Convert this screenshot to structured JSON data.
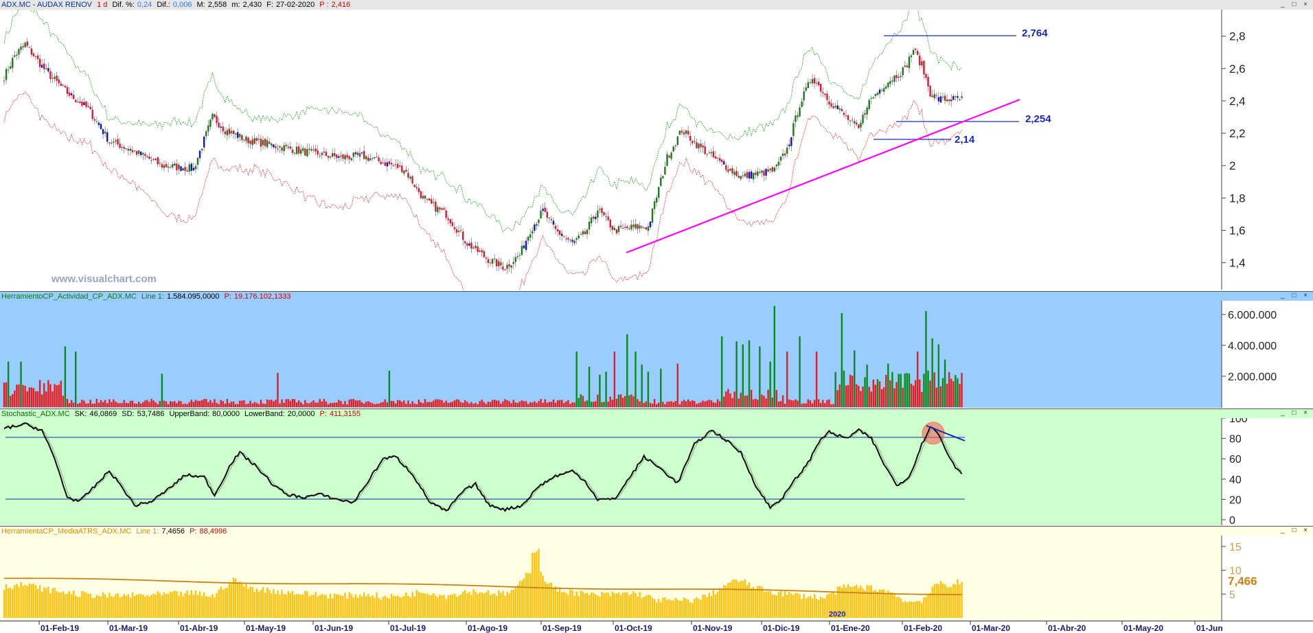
{
  "panel1": {
    "symbol": "ADX.MC - AUDAX RENOV",
    "period": "1 d",
    "dif_pct_label": "Dif. %:",
    "dif_pct": "0,24",
    "dif_label": "Dif.:",
    "dif": "0,006",
    "max_label": "M:",
    "max": "2,558",
    "min_label": "m:",
    "min": "2,430",
    "date_label": "F:",
    "date": "27-02-2020",
    "price_label": "P :",
    "price": "2,416",
    "watermark": "www.visualchart.com",
    "yticks": [
      "2,8",
      "2,6",
      "2,4",
      "2,2",
      "2",
      "1,8",
      "1,6",
      "1,4"
    ],
    "annotations": [
      "2,764",
      "2,254",
      "2,14"
    ]
  },
  "panel2": {
    "name": "HerramientoCP_Actividad_CP_ADX.MC",
    "line_label": "Line 1:",
    "line_value": "1.584.095,0000",
    "p_label": "P:",
    "p_value": "19.176.102,1333",
    "yticks": [
      "6.000.000",
      "4.000.000",
      "2.000.000"
    ]
  },
  "panel3": {
    "name": "Stochastic_ADX.MC",
    "sk_label": "SK:",
    "sk": "46,0869",
    "sd_label": "SD:",
    "sd": "53,7486",
    "ub_label": "UpperBand:",
    "ub": "80,0000",
    "lb_label": "LowerBand:",
    "lb": "20,0000",
    "p_label": "P:",
    "p_value": "411,3155",
    "yticks": [
      "100",
      "80",
      "60",
      "40",
      "20",
      "0"
    ]
  },
  "panel4": {
    "name": "HerramientaCP_MediaATRS_ADX.MC",
    "line_label": "Line 1:",
    "line_value": "7,4656",
    "p_label": "P:",
    "p_value": "88,4996",
    "yticks": [
      "15",
      "10",
      "5"
    ],
    "last_value": "7,466",
    "year_marker": "2020"
  },
  "xaxis": [
    "01-Feb-19",
    "01-Mar-19",
    "01-Abr-19",
    "01-May-19",
    "01-Jun-19",
    "01-Jul-19",
    "01-Ago-19",
    "01-Sep-19",
    "01-Oct-19",
    "01-Nov-19",
    "01-Dic-19",
    "01-Ene-20",
    "01-Feb-20",
    "01-Mar-20",
    "01-Abr-20",
    "01-May-20",
    "01-Jun"
  ],
  "window_buttons": "_ □ ×",
  "colors": {
    "up": "#1a7a1a",
    "down": "#e8112d",
    "blue": "#1010c0",
    "magenta": "#ff00ff",
    "band_upper": "#0a9a0a",
    "band_lower": "#e82020",
    "vol_bg": "#99ccff",
    "stoch_bg": "#ccffcc",
    "atr_bg": "#ffffe6",
    "atr_bar": "#ffc20e",
    "atr_line": "#c88214"
  },
  "chart_data": [
    {
      "type": "candlestick",
      "title": "ADX.MC - AUDAX RENOV",
      "y_range": [
        1.25,
        2.93
      ],
      "annotated_levels": [
        2.764,
        2.254,
        2.14
      ],
      "monthly_close_approx": {
        "months": [
          "Feb-19",
          "Mar-19",
          "Abr-19",
          "May-19",
          "Jun-19",
          "Jul-19",
          "Ago-19",
          "Sep-19",
          "Oct-19",
          "Nov-19",
          "Dic-19",
          "Ene-20",
          "Feb-20"
        ],
        "close": [
          2.62,
          2.08,
          1.99,
          2.22,
          2.08,
          2.05,
          1.68,
          1.57,
          1.62,
          2.02,
          2.05,
          2.35,
          2.42
        ]
      },
      "anchors": [
        [
          0,
          2.55
        ],
        [
          5,
          2.68
        ],
        [
          10,
          2.75
        ],
        [
          20,
          2.58
        ],
        [
          30,
          2.45
        ],
        [
          40,
          2.35
        ],
        [
          50,
          2.15
        ],
        [
          60,
          2.1
        ],
        [
          75,
          2.0
        ],
        [
          90,
          1.98
        ],
        [
          99,
          2.3
        ],
        [
          105,
          2.22
        ],
        [
          115,
          2.16
        ],
        [
          130,
          2.12
        ],
        [
          145,
          2.08
        ],
        [
          160,
          2.05
        ],
        [
          170,
          2.06
        ],
        [
          180,
          2.02
        ],
        [
          190,
          1.98
        ],
        [
          200,
          1.78
        ],
        [
          210,
          1.7
        ],
        [
          220,
          1.52
        ],
        [
          230,
          1.42
        ],
        [
          238,
          1.37
        ],
        [
          245,
          1.45
        ],
        [
          250,
          1.6
        ],
        [
          256,
          1.72
        ],
        [
          262,
          1.6
        ],
        [
          270,
          1.52
        ],
        [
          276,
          1.58
        ],
        [
          282,
          1.73
        ],
        [
          290,
          1.6
        ],
        [
          300,
          1.62
        ],
        [
          306,
          1.62
        ],
        [
          315,
          2.05
        ],
        [
          322,
          2.22
        ],
        [
          330,
          2.12
        ],
        [
          340,
          2.02
        ],
        [
          350,
          1.93
        ],
        [
          358,
          1.95
        ],
        [
          366,
          1.97
        ],
        [
          372,
          2.1
        ],
        [
          378,
          2.38
        ],
        [
          384,
          2.55
        ],
        [
          392,
          2.4
        ],
        [
          400,
          2.3
        ],
        [
          406,
          2.22
        ],
        [
          410,
          2.38
        ],
        [
          418,
          2.5
        ],
        [
          424,
          2.56
        ],
        [
          428,
          2.6
        ],
        [
          432,
          2.72
        ],
        [
          436,
          2.62
        ],
        [
          440,
          2.45
        ],
        [
          444,
          2.41
        ]
      ]
    },
    {
      "type": "bar",
      "title": "HerramientoCP_Actividad_CP_ADX.MC",
      "y_range": [
        0,
        6800000
      ],
      "peaks": [
        {
          "month": "Ene-20",
          "value": 6550000
        },
        {
          "month": "Feb-20",
          "value": 6300000
        },
        {
          "month": "Nov-19",
          "value": 3500000
        },
        {
          "month": "May-19",
          "value": 2600000
        },
        {
          "month": "Sep-19",
          "value": 2500000
        }
      ],
      "last_value": 1584095
    },
    {
      "type": "line",
      "title": "Stochastic_ADX.MC",
      "y_range": [
        0,
        100
      ],
      "bands": [
        80,
        20
      ],
      "last": {
        "SK": 46.0869,
        "SD": 53.7486
      },
      "sk_anchors": [
        [
          0,
          90
        ],
        [
          10,
          94
        ],
        [
          18,
          88
        ],
        [
          24,
          60
        ],
        [
          30,
          22
        ],
        [
          36,
          18
        ],
        [
          44,
          35
        ],
        [
          50,
          48
        ],
        [
          56,
          32
        ],
        [
          62,
          14
        ],
        [
          70,
          18
        ],
        [
          78,
          30
        ],
        [
          86,
          44
        ],
        [
          95,
          42
        ],
        [
          100,
          24
        ],
        [
          108,
          56
        ],
        [
          112,
          66
        ],
        [
          120,
          52
        ],
        [
          128,
          34
        ],
        [
          134,
          25
        ],
        [
          142,
          22
        ],
        [
          150,
          25
        ],
        [
          158,
          20
        ],
        [
          166,
          17
        ],
        [
          172,
          35
        ],
        [
          180,
          60
        ],
        [
          186,
          62
        ],
        [
          194,
          45
        ],
        [
          202,
          18
        ],
        [
          210,
          8
        ],
        [
          218,
          28
        ],
        [
          224,
          35
        ],
        [
          230,
          15
        ],
        [
          238,
          10
        ],
        [
          246,
          14
        ],
        [
          254,
          33
        ],
        [
          262,
          43
        ],
        [
          270,
          48
        ],
        [
          276,
          38
        ],
        [
          282,
          20
        ],
        [
          290,
          20
        ],
        [
          296,
          38
        ],
        [
          304,
          62
        ],
        [
          312,
          50
        ],
        [
          320,
          36
        ],
        [
          328,
          74
        ],
        [
          336,
          88
        ],
        [
          342,
          80
        ],
        [
          350,
          66
        ],
        [
          358,
          30
        ],
        [
          364,
          12
        ],
        [
          370,
          22
        ],
        [
          376,
          40
        ],
        [
          382,
          56
        ],
        [
          388,
          80
        ],
        [
          392,
          86
        ],
        [
          400,
          80
        ],
        [
          406,
          88
        ],
        [
          412,
          80
        ],
        [
          418,
          55
        ],
        [
          424,
          34
        ],
        [
          430,
          42
        ],
        [
          436,
          74
        ],
        [
          440,
          92
        ],
        [
          444,
          84
        ],
        [
          448,
          66
        ],
        [
          452,
          52
        ],
        [
          455,
          46
        ]
      ]
    },
    {
      "type": "bar",
      "title": "HerramientaCP_MediaATRS_ADX.MC",
      "y_range": [
        0,
        17
      ],
      "average_line": [
        8.5,
        5.0
      ],
      "last_value": 7.4656,
      "peak": {
        "month": "Sep-19",
        "value": 14.5
      }
    }
  ]
}
